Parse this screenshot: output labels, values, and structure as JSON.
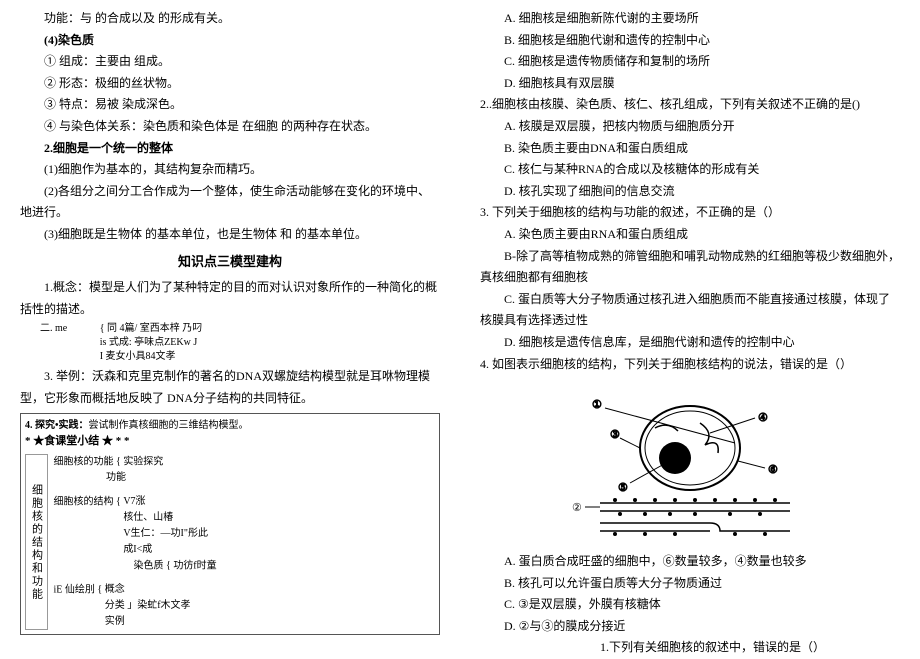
{
  "left": {
    "p1": "功能：与 的合成以及 的形成有关。",
    "h_chrom": "(4)染色质",
    "chrom1": "① 组成：主要由 组成。",
    "chrom2": "② 形态：极细的丝状物。",
    "chrom3": "③ 特点：易被 染成深色。",
    "chrom4": "④ 与染色体关系：染色质和染色体是 在细胞 的两种存在状态。",
    "h_unity": "2.细胞是一个统一的整体",
    "unity1": "(1)细胞作为基本的，其结构复杂而精巧。",
    "unity2": "(2)各组分之间分工合作成为一个整体，使生命活动能够在变化的环境中、地进行。",
    "unity3": "(3)细胞既是生物体 的基本单位，也是生物体 和 的基本单位。",
    "h_model": "知识点三模型建构",
    "model1": "1.概念：模型是人们为了某种特定的目的而对认识对象所作的一种简化的概括性的描述。",
    "model_me_prefix": "二. me",
    "model_me_line1": "{ 同 4篇/ 室西本梓 乃叼",
    "model_me_line2": "is 式成: 亭味点ZEKw J",
    "model_me_line3": "I 麦女小具84文孝",
    "model3": "3. 举例：沃森和克里克制作的著名的DNA双螺旋结构模型就是耳咻物理模 型，它形象而概括地反映了 DNA分子结构的共同特征。",
    "model4_prefix": "4. 探究•实践：",
    "model4_rest": "尝试制作真核细胞的三维结构模型。",
    "summary_header": "* ★食课堂小结 ★ * *",
    "summary_vert": "细胞核的结构和功能",
    "sum_func_label": "细胞核的功能",
    "sum_func1": "实验探究",
    "sum_func2": "功能",
    "sum_struct_label": "细胞核的结构",
    "sum_struct1": "V7涨",
    "sum_struct2": "核仕、山椿",
    "sum_struct3": "V生仁：—功I\"彤此",
    "sum_struct4": "成I<成",
    "sum_chrom_label": "染色质",
    "sum_chrom_val": "功彷f时童",
    "sum_ie_label": "iE 仙绘刖",
    "sum_ie1": "概念",
    "sum_ie2": "分类",
    "sum_ie3": "实例",
    "sum_ie_val": "」染虻f木文孝"
  },
  "right": {
    "q1_stem": "1.下列有关细胞核的叙述中，错误的是（）",
    "q1a": "A. 细胞核是细胞新陈代谢的主要场所",
    "q1b": "B. 细胞核是细胞代谢和遗传的控制中心",
    "q1c": "C. 细胞核是遗传物质储存和复制的场所",
    "q1d": "D. 细胞核具有双层膜",
    "q2_stem": "2..细胞核由核膜、染色质、核仁、核孔组成，下列有关叙述不正确的是()",
    "q2a": "A. 核膜是双层膜，把核内物质与细胞质分开",
    "q2b": "B. 染色质主要由DNA和蛋白质组成",
    "q2c": "C. 核仁与某种RNA的合成以及核糖体的形成有关",
    "q2d": "D. 核孔实现了细胞间的信息交流",
    "q3_stem": "3.    下列关于细胞核的结构与功能的叙述，不正确的是（）",
    "q3a": "A. 染色质主要由RNA和蛋白质组成",
    "q3b": "B-除了高等植物成熟的筛管细胞和哺乳动物成熟的红细胞等极少数细胞外，真核细胞都有细胞核",
    "q3c": "C. 蛋白质等大分子物质通过核孔进入细胞质而不能直接通过核膜，体现了 核膜具有选择透过性",
    "q3d": "D. 细胞核是遗传信息库，是细胞代谢和遗传的控制中心",
    "q4_stem": "4.    如图表示细胞核的结构，下列关于细胞核结构的说法，错误的是（）",
    "q4a": "A. 蛋白质合成旺盛的细胞中，⑥数量较多，④数量也较多",
    "q4b": "B. 核孔可以允许蛋白质等大分子物质通过",
    "q4c": "C. ③是双层膜，外膜有核糖体",
    "q4d": "D. ②与③的膜成分接近",
    "labels": {
      "l1": "①",
      "l2": "②",
      "l3": "③",
      "l4": "④",
      "l5": "⑤",
      "l6": "⑥"
    }
  }
}
